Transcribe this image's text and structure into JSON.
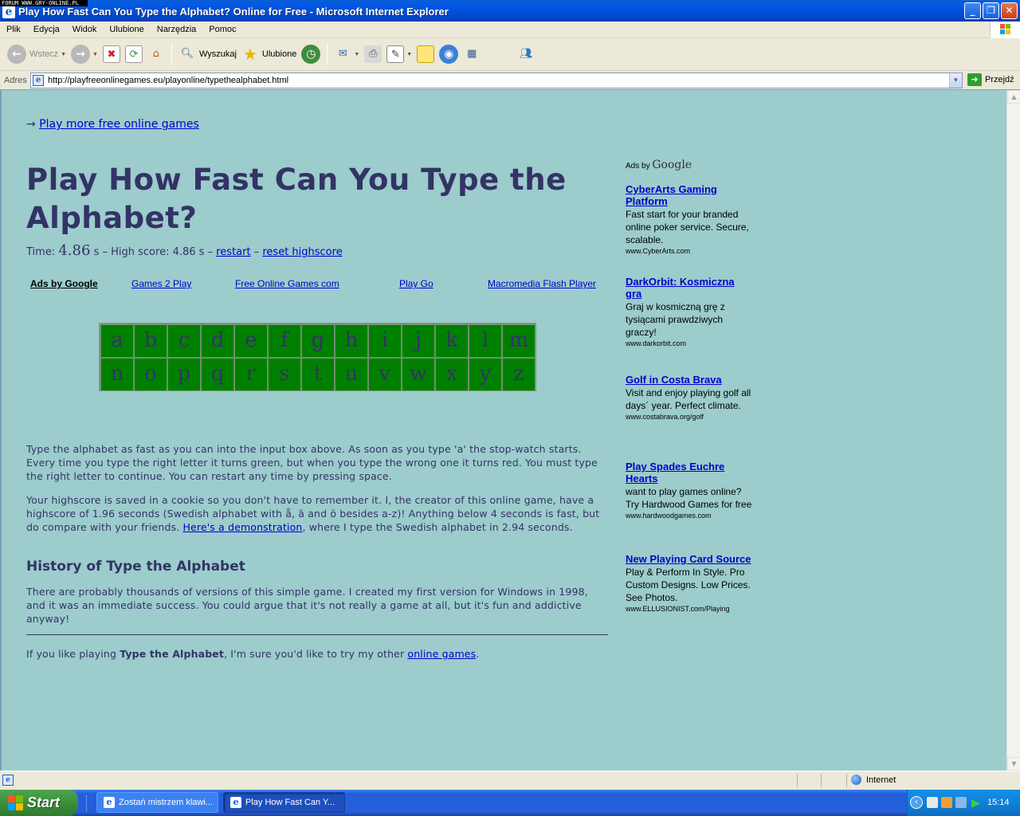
{
  "watermark": "FORUM WWW.GRY-ONLINE.PL",
  "window": {
    "title": "Play How Fast Can You Type the Alphabet? Online for Free - Microsoft Internet Explorer",
    "app_icon_glyph": "e",
    "minimize": "_",
    "maximize": "❐",
    "close": "✕"
  },
  "menu": [
    "Plik",
    "Edycja",
    "Widok",
    "Ulubione",
    "Narzędzia",
    "Pomoc"
  ],
  "toolbar": {
    "back": "Wstecz",
    "search": "Wyszukaj",
    "favorites": "Ulubione"
  },
  "address": {
    "label": "Adres",
    "url": "http://playfreeonlinegames.eu/playonline/typethealphabet.html",
    "go": "Przejdź"
  },
  "page": {
    "more_games_arrow": "→",
    "more_games_link": "Play more free online games",
    "title": "Play How Fast Can You Type the Alphabet?",
    "timer": {
      "time_label": "Time:",
      "time_value": "4.86",
      "time_unit": "s",
      "sep1": "–",
      "highscore_label": "High score:",
      "highscore_value": "4.86 s",
      "sep2": "–",
      "restart": "restart",
      "sep3": "–",
      "reset": "reset highscore"
    },
    "ad_links": {
      "header": "Ads by Google",
      "links": [
        "Games 2 Play",
        "Free Online Games com",
        "Play Go",
        "Macromedia Flash Player"
      ]
    },
    "letters": [
      "a",
      "b",
      "c",
      "d",
      "e",
      "f",
      "g",
      "h",
      "i",
      "j",
      "k",
      "l",
      "m",
      "n",
      "o",
      "p",
      "q",
      "r",
      "s",
      "t",
      "u",
      "v",
      "w",
      "x",
      "y",
      "z"
    ],
    "para1": "Type the alphabet as fast as you can into the input box above. As soon as you type 'a' the stop-watch starts. Every time you type the right letter it turns green, but when you type the wrong one it turns red. You must type the right letter to continue. You can restart any time by pressing space.",
    "para2_before": "Your highscore is saved in a cookie so you don't have to remember it. I, the creator of this online game, have a highscore of 1.96 seconds (Swedish alphabet with å, ä and ö besides a-z)! Anything below 4 seconds is fast, but do compare with your friends. ",
    "para2_link": "Here's a demonstration",
    "para2_after": ", where I type the Swedish alphabet in 2.94 seconds.",
    "history_heading": "History of Type the Alphabet",
    "para3": "There are probably thousands of versions of this simple game. I created my first version for Windows in 1998, and it was an immediate success. You could argue that it's not really a game at all, but it's fun and addictive anyway!",
    "footer_before": "If you like playing ",
    "footer_bold": "Type the Alphabet",
    "footer_middle": ", I'm sure you'd like to try my other ",
    "footer_link": "online games",
    "footer_after": "."
  },
  "ads": {
    "header_prefix": "Ads by",
    "header_brand": "Google",
    "items": [
      {
        "title": "CyberArts Gaming Platform",
        "body": "Fast start for your branded online poker service. Secure, scalable.",
        "url": "www.CyberArts.com"
      },
      {
        "title": "DarkOrbit: Kosmiczna gra",
        "body": "Graj w kosmiczną grę z tysiącami prawdziwych graczy!",
        "url": "www.darkorbit.com"
      },
      {
        "title": "Golf in Costa Brava",
        "body": "Visit and enjoy playing golf all days´ year. Perfect climate.",
        "url": "www.costabrava.org/golf"
      },
      {
        "title": "Play Spades Euchre Hearts",
        "body": "want to play games online? Try Hardwood Games for free",
        "url": "www.hardwoodgames.com"
      },
      {
        "title": "New Playing Card Source",
        "body": "Play & Perform In Style. Pro Custom Designs. Low Prices. See Photos.",
        "url": "www.ELLUSIONIST.com/Playing"
      }
    ]
  },
  "status": {
    "zone": "Internet"
  },
  "taskbar": {
    "start": "Start",
    "tasks": [
      "Zostań mistrzem klawi...",
      "Play How Fast Can Y..."
    ],
    "clock": "15:14"
  }
}
